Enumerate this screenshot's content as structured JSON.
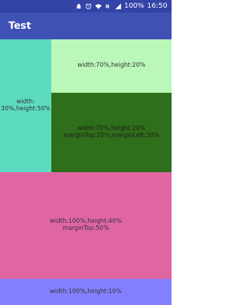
{
  "status_bar": {
    "icons": [
      "notifications-off-icon",
      "alarm-icon",
      "wifi-icon",
      "4g-icon",
      "signal-icon"
    ],
    "battery_percent": "100%",
    "time": "16:50",
    "text_color": "#ffffff"
  },
  "app_bar": {
    "title": "Test",
    "color": "#3f51b5"
  },
  "blocks": {
    "left": {
      "text": "width:\n30%,height:50%",
      "color": "#5ddbc0"
    },
    "top_right": {
      "text": "width:70%,height:20%",
      "color": "#baf7b8"
    },
    "dark": {
      "text": "width:70%,height:20%\nmarginTop:20%,marginLeft:30%",
      "color": "#2f6e1b"
    },
    "pink": {
      "text": "width:100%,height:40%\nmarginTop:50%",
      "color": "#df66a3"
    },
    "purple": {
      "text": "width:100%,height:10%",
      "color": "#8280ff"
    }
  }
}
